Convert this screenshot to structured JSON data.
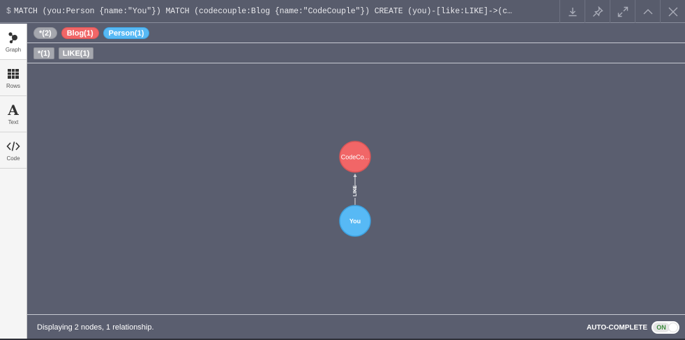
{
  "query": {
    "prompt": "$",
    "text": "MATCH (you:Person {name:\"You\"}) MATCH (codecouple:Blog {name:\"CodeCouple\"}) CREATE (you)-[like:LIKE]->(c…"
  },
  "top_actions": [
    "download-icon",
    "pin-icon",
    "expand-icon",
    "collapse-icon",
    "close-icon"
  ],
  "sidebar": {
    "items": [
      {
        "label": "Graph",
        "icon": "graph-icon",
        "active": true
      },
      {
        "label": "Rows",
        "icon": "table-icon",
        "active": false
      },
      {
        "label": "Text",
        "icon": "text-icon",
        "active": false
      },
      {
        "label": "Code",
        "icon": "code-icon",
        "active": false
      }
    ]
  },
  "legend": {
    "labels": [
      {
        "text": "*(2)",
        "color": "#a5a7ae"
      },
      {
        "text": "Blog(1)",
        "color": "#f16667"
      },
      {
        "text": "Person(1)",
        "color": "#57b9f5"
      }
    ],
    "relationships": [
      {
        "text": "*(1)"
      },
      {
        "text": "LIKE(1)"
      }
    ]
  },
  "graph": {
    "nodes": [
      {
        "id": "codecouple",
        "caption": "CodeCo...",
        "color": "#f16667"
      },
      {
        "id": "you",
        "caption": "You",
        "color": "#57b9f5"
      }
    ],
    "relationships": [
      {
        "from": "you",
        "to": "codecouple",
        "type": "LIKE"
      }
    ]
  },
  "footer": {
    "status": "Displaying 2 nodes, 1 relationship.",
    "autocomplete_label": "AUTO-COMPLETE",
    "toggle_state": "ON"
  }
}
